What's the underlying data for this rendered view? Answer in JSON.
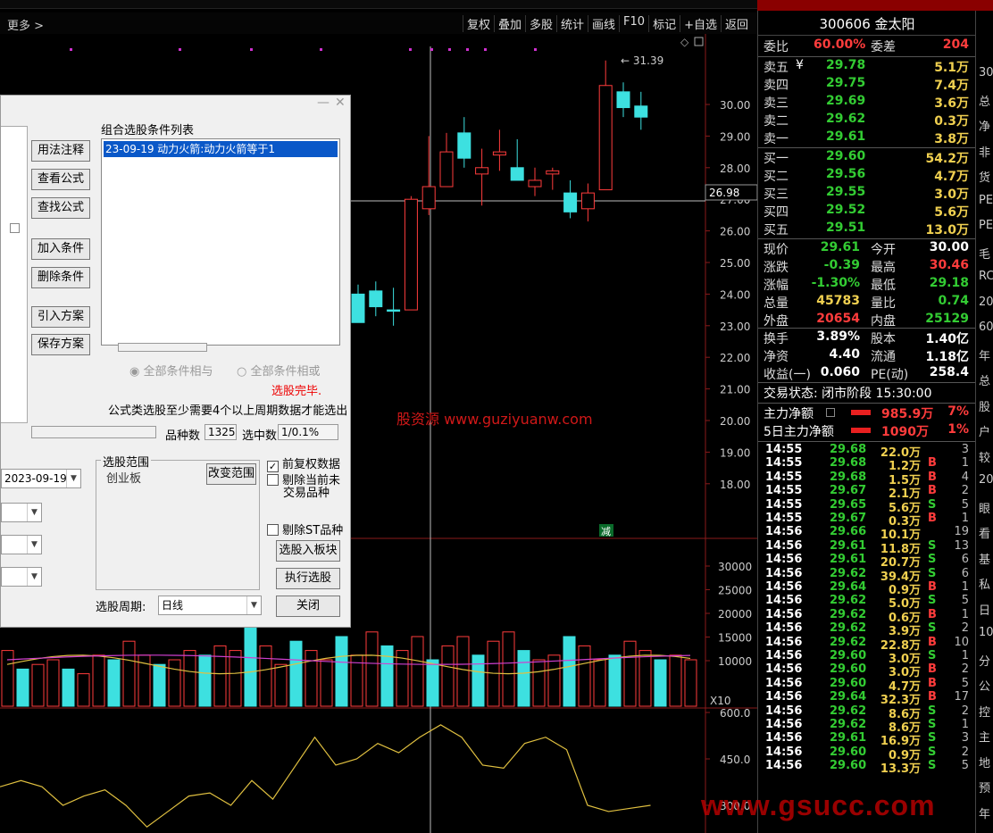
{
  "toolbar": {
    "more": "更多 >",
    "items": [
      "复权",
      "叠加",
      "多股",
      "统计",
      "画线",
      "F10",
      "标记",
      "+自选",
      "返回"
    ]
  },
  "chart": {
    "high_label": "31.39",
    "crosshair_price": "26.98",
    "price_ticks": [
      "30.00",
      "29.00",
      "28.00",
      "27.00",
      "26.00",
      "25.00",
      "24.00",
      "23.00",
      "22.00",
      "21.00",
      "20.00",
      "19.00",
      "18.00"
    ],
    "vol_ticks": [
      "30000",
      "25000",
      "20000",
      "15000",
      "10000"
    ],
    "vol_unit": "X10",
    "ind_ticks": [
      "600.0",
      "450.0",
      "300.0"
    ],
    "reduce_tag": "减",
    "candles": [
      {
        "o": 24.0,
        "c": 23.1,
        "h": 24.3,
        "l": 23.1,
        "up": false
      },
      {
        "o": 23.6,
        "c": 24.1,
        "h": 24.4,
        "l": 23.3,
        "up": false
      },
      {
        "o": 23.5,
        "c": 23.5,
        "h": 24.2,
        "l": 23.0,
        "up": false
      },
      {
        "o": 23.5,
        "c": 27.0,
        "h": 27.1,
        "l": 23.5,
        "up": true
      },
      {
        "o": 26.7,
        "c": 27.4,
        "h": 29.0,
        "l": 26.5,
        "up": true
      },
      {
        "o": 27.4,
        "c": 28.5,
        "h": 29.1,
        "l": 27.4,
        "up": true
      },
      {
        "o": 29.1,
        "c": 28.3,
        "h": 29.6,
        "l": 28.0,
        "up": false
      },
      {
        "o": 27.8,
        "c": 28.0,
        "h": 28.6,
        "l": 26.8,
        "up": true
      },
      {
        "o": 28.4,
        "c": 28.5,
        "h": 29.2,
        "l": 27.9,
        "up": true
      },
      {
        "o": 28.0,
        "c": 27.6,
        "h": 28.9,
        "l": 27.6,
        "up": false
      },
      {
        "o": 27.6,
        "c": 27.4,
        "h": 28.0,
        "l": 27.1,
        "up": true
      },
      {
        "o": 27.8,
        "c": 27.9,
        "h": 28.0,
        "l": 27.3,
        "up": true
      },
      {
        "o": 27.2,
        "c": 26.6,
        "h": 27.6,
        "l": 26.4,
        "up": false
      },
      {
        "o": 26.7,
        "c": 27.2,
        "h": 27.5,
        "l": 26.3,
        "up": true
      },
      {
        "o": 27.3,
        "c": 30.6,
        "h": 31.39,
        "l": 27.3,
        "up": true
      },
      {
        "o": 30.4,
        "c": 29.9,
        "h": 30.7,
        "l": 29.6,
        "up": false
      },
      {
        "o": 29.95,
        "c": 29.6,
        "h": 30.4,
        "l": 29.2,
        "up": false
      }
    ],
    "volumes": [
      12,
      8,
      9,
      10,
      8,
      7,
      11,
      10,
      14,
      11,
      9,
      10,
      12,
      11,
      13,
      12,
      17,
      13,
      9,
      14,
      12,
      10,
      15,
      11,
      16,
      13,
      12,
      15,
      10,
      13,
      15,
      11,
      14,
      16,
      12,
      10,
      11,
      15,
      13,
      10,
      11,
      14,
      12,
      10,
      11,
      10
    ],
    "indicator": [
      360,
      380,
      360,
      300,
      330,
      350,
      300,
      230,
      280,
      330,
      340,
      300,
      380,
      320,
      420,
      520,
      430,
      450,
      500,
      470,
      520,
      560,
      520,
      430,
      420,
      500,
      520,
      480,
      300,
      280,
      290,
      300
    ]
  },
  "dialog": {
    "list_label": "组合选股条件列表",
    "condition_item": "23-09-19 动力火箭:动力火箭等于1",
    "buttons": {
      "explain": "用法注释",
      "view": "查看公式",
      "find": "查找公式",
      "add": "加入条件",
      "delete": "删除条件",
      "import": "引入方案",
      "save": "保存方案",
      "to_block": "选股入板块",
      "run": "执行选股",
      "close": "关闭",
      "change_range": "改变范围"
    },
    "radio_and": "全部条件相与",
    "radio_or": "全部条件相或",
    "status": "选股完毕.",
    "note": "公式类选股至少需要4个以上周期数据才能选出",
    "count_label": "品种数",
    "count_value": "1325",
    "selected_label": "选中数",
    "selected_value": "1/0.1%",
    "range_title": "选股范围",
    "range_board": "创业板",
    "chk_prior": "前复权数据",
    "chk_exclude_untraded_1": "剔除当前未",
    "chk_exclude_untraded_2": "交易品种",
    "chk_exclude_st": "剔除ST品种",
    "date_value": "2023-09-19",
    "period_label": "选股周期:",
    "period_value": "日线"
  },
  "panel": {
    "code_name": "300606 金太阳",
    "wb_label": "委比",
    "wb_value": "60.00%",
    "wc_label": "委差",
    "wc_value": "204",
    "asks": [
      {
        "label": "卖五",
        "price": "29.78",
        "vol": "5.1万"
      },
      {
        "label": "卖四",
        "price": "29.75",
        "vol": "7.4万"
      },
      {
        "label": "卖三",
        "price": "29.69",
        "vol": "3.6万"
      },
      {
        "label": "卖二",
        "price": "29.62",
        "vol": "0.3万"
      },
      {
        "label": "卖一",
        "price": "29.61",
        "vol": "3.8万"
      }
    ],
    "ask5_symbol": "¥",
    "bids": [
      {
        "label": "买一",
        "price": "29.60",
        "vol": "54.2万"
      },
      {
        "label": "买二",
        "price": "29.56",
        "vol": "4.7万"
      },
      {
        "label": "买三",
        "price": "29.55",
        "vol": "3.0万"
      },
      {
        "label": "买四",
        "price": "29.52",
        "vol": "5.6万"
      },
      {
        "label": "买五",
        "price": "29.51",
        "vol": "13.0万"
      }
    ],
    "stats": [
      {
        "l1": "现价",
        "v1": "29.61",
        "c1": "grn",
        "l2": "今开",
        "v2": "30.00",
        "c2": "wht"
      },
      {
        "l1": "涨跌",
        "v1": "-0.39",
        "c1": "grn",
        "l2": "最高",
        "v2": "30.46",
        "c2": "red"
      },
      {
        "l1": "涨幅",
        "v1": "-1.30%",
        "c1": "grn",
        "l2": "最低",
        "v2": "29.18",
        "c2": "grn"
      },
      {
        "l1": "总量",
        "v1": "45783",
        "c1": "yel",
        "l2": "量比",
        "v2": "0.74",
        "c2": "grn"
      },
      {
        "l1": "外盘",
        "v1": "20654",
        "c1": "red",
        "l2": "内盘",
        "v2": "25129",
        "c2": "grn"
      }
    ],
    "stats2": [
      {
        "l1": "换手",
        "v1": "3.89%",
        "c1": "wht",
        "l2": "股本",
        "v2": "1.40亿",
        "c2": "wht"
      },
      {
        "l1": "净资",
        "v1": "4.40",
        "c1": "wht",
        "l2": "流通",
        "v2": "1.18亿",
        "c2": "wht"
      },
      {
        "l1": "收益(一)",
        "v1": "0.060",
        "c1": "wht",
        "l2": "PE(动)",
        "v2": "258.4",
        "c2": "wht"
      }
    ],
    "trade_status": "交易状态: 闭市阶段 15:30:00",
    "main_flow_label": "主力净额",
    "main_flow_value": "985.9万",
    "main_flow_pct": "7%",
    "flow5_label": "5日主力净额",
    "flow5_value": "1090万",
    "flow5_pct": "1%",
    "ticks": [
      [
        "14:55",
        "29.68",
        "22.0万",
        "",
        "3"
      ],
      [
        "14:55",
        "29.68",
        "1.2万",
        "B",
        "1"
      ],
      [
        "14:55",
        "29.68",
        "1.5万",
        "B",
        "4"
      ],
      [
        "14:55",
        "29.67",
        "2.1万",
        "B",
        "2"
      ],
      [
        "14:55",
        "29.65",
        "5.6万",
        "S",
        "5"
      ],
      [
        "14:55",
        "29.67",
        "0.3万",
        "B",
        "1"
      ],
      [
        "14:56",
        "29.66",
        "10.1万",
        "",
        "19"
      ],
      [
        "14:56",
        "29.61",
        "11.8万",
        "S",
        "13"
      ],
      [
        "14:56",
        "29.61",
        "20.7万",
        "S",
        "6"
      ],
      [
        "14:56",
        "29.62",
        "39.4万",
        "S",
        "6"
      ],
      [
        "14:56",
        "29.64",
        "0.9万",
        "B",
        "1"
      ],
      [
        "14:56",
        "29.62",
        "5.0万",
        "S",
        "5"
      ],
      [
        "14:56",
        "29.62",
        "0.6万",
        "B",
        "1"
      ],
      [
        "14:56",
        "29.62",
        "3.9万",
        "S",
        "2"
      ],
      [
        "14:56",
        "29.62",
        "22.8万",
        "B",
        "10"
      ],
      [
        "14:56",
        "29.60",
        "3.0万",
        "S",
        "1"
      ],
      [
        "14:56",
        "29.60",
        "3.0万",
        "B",
        "2"
      ],
      [
        "14:56",
        "29.60",
        "4.7万",
        "B",
        "5"
      ],
      [
        "14:56",
        "29.64",
        "32.3万",
        "B",
        "17"
      ],
      [
        "14:56",
        "29.62",
        "8.6万",
        "S",
        "2"
      ],
      [
        "14:56",
        "29.62",
        "8.6万",
        "S",
        "1"
      ],
      [
        "14:56",
        "29.61",
        "16.9万",
        "S",
        "3"
      ],
      [
        "14:56",
        "29.60",
        "0.9万",
        "S",
        "2"
      ],
      [
        "14:56",
        "29.60",
        "13.3万",
        "S",
        "5"
      ]
    ]
  },
  "far_right": {
    "items": [
      "30",
      "总",
      "净",
      "非",
      "货",
      "PE",
      "PE",
      "毛",
      "RC",
      "20",
      "60",
      "年",
      "总",
      "股",
      "户",
      "较",
      "20",
      "眼",
      "看",
      "基",
      "私",
      "日",
      "10",
      "分",
      "公",
      "控",
      "主",
      "地",
      "预",
      "年"
    ]
  },
  "watermarks": {
    "center": "股资源 www.guziyuanw.com",
    "corner": "www.gsucc.com"
  }
}
